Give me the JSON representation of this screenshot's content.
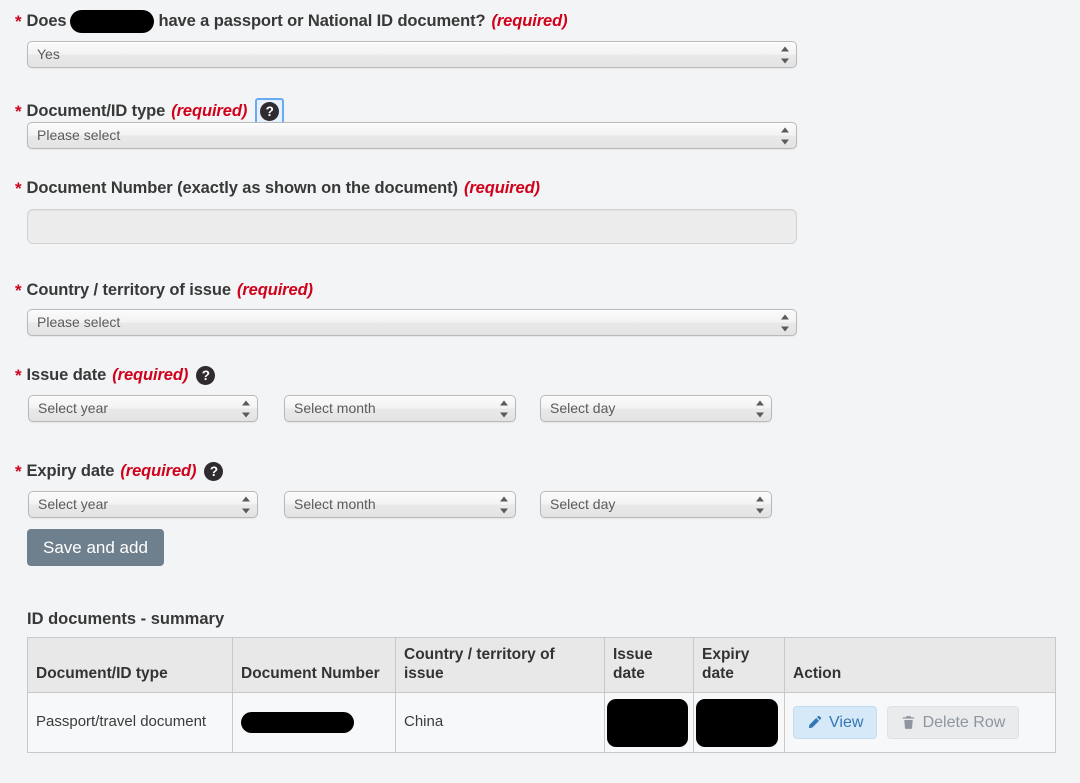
{
  "form": {
    "questions": [
      {
        "id": "passport-question",
        "prefix": "Does",
        "redacted": true,
        "suffix": "have a passport or National ID document?",
        "required_text": "(required)",
        "control": "select",
        "value": "Yes",
        "help": false
      },
      {
        "id": "document-id-type",
        "label": "Document/ID type",
        "required_text": "(required)",
        "control": "select",
        "value": "Please select",
        "help": true,
        "help_focused": true,
        "help_glyph": "?"
      },
      {
        "id": "document-number",
        "label": "Document Number (exactly as shown on the document)",
        "required_text": "(required)",
        "control": "text",
        "value": "",
        "help": false
      },
      {
        "id": "country-of-issue",
        "label": "Country / territory of issue",
        "required_text": "(required)",
        "control": "select",
        "value": "Please select",
        "help": false
      },
      {
        "id": "issue-date",
        "label": "Issue date",
        "required_text": "(required)",
        "control": "date",
        "help": true,
        "help_focused": false,
        "help_glyph": "?",
        "year": "Select year",
        "month": "Select month",
        "day": "Select day"
      },
      {
        "id": "expiry-date",
        "label": "Expiry date",
        "required_text": "(required)",
        "control": "date",
        "help": true,
        "help_focused": false,
        "help_glyph": "?",
        "year": "Select year",
        "month": "Select month",
        "day": "Select day"
      }
    ],
    "save_button": "Save and add"
  },
  "summary": {
    "title": "ID documents - summary",
    "columns": [
      "Document/ID type",
      "Document Number",
      "Country / territory of issue",
      "Issue date",
      "Expiry date",
      "Action"
    ],
    "rows": [
      {
        "document_type": "Passport/travel document",
        "document_number": "",
        "document_number_redacted": true,
        "country": "China",
        "issue_date": "",
        "issue_date_redacted": true,
        "expiry_date": "",
        "expiry_date_redacted": true,
        "view_label": "View",
        "view_icon": "pencil-icon",
        "delete_label": "Delete Row",
        "delete_icon": "trash-icon"
      }
    ]
  },
  "colors": {
    "page_background": "#f2f4f6",
    "required_red": "#d0021b",
    "label_dark": "#383838",
    "save_button": "#6e7f8d",
    "view_button_bg": "#d6e9f8",
    "view_button_text": "#3278b4",
    "delete_button_bg": "#e9ebec",
    "delete_button_text": "#8d96a0",
    "table_header_bg": "#e8e8e8",
    "redaction": "#000000"
  }
}
